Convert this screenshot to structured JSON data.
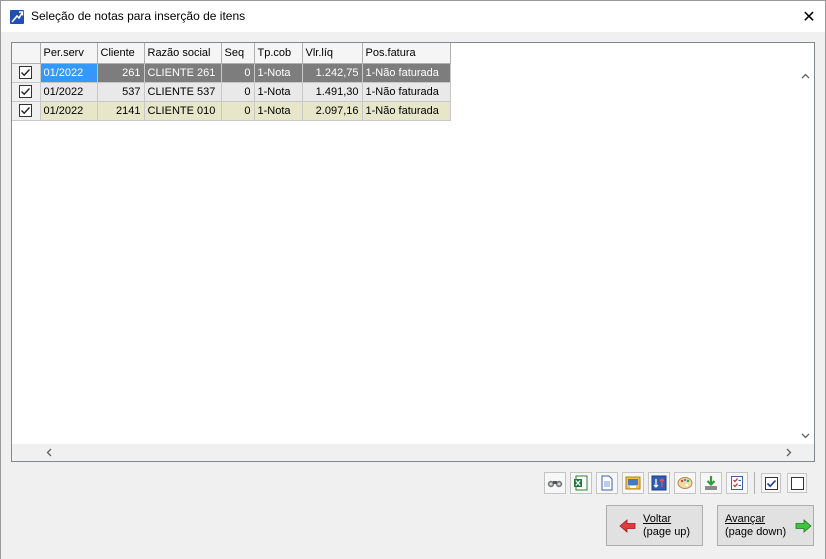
{
  "window": {
    "title": "Seleção de notas para inserção de itens",
    "close_glyph": "✕"
  },
  "grid": {
    "columns": [
      "Per.serv",
      "Cliente",
      "Razão social",
      "Seq",
      "Tp.cob",
      "Vlr.líq",
      "Pos.fatura"
    ],
    "rows": [
      {
        "checked": true,
        "per_serv": "01/2022",
        "cliente": "261",
        "razao": "CLIENTE 261",
        "seq": "0",
        "tp_cob": "1-Nota",
        "vlr_liq": "1.242,75",
        "pos_fatura": "1-Não faturada"
      },
      {
        "checked": true,
        "per_serv": "01/2022",
        "cliente": "537",
        "razao": "CLIENTE 537",
        "seq": "0",
        "tp_cob": "1-Nota",
        "vlr_liq": "1.491,30",
        "pos_fatura": "1-Não faturada"
      },
      {
        "checked": true,
        "per_serv": "01/2022",
        "cliente": "2141",
        "razao": "CLIENTE 010",
        "seq": "0",
        "tp_cob": "1-Nota",
        "vlr_liq": "2.097,16",
        "pos_fatura": "1-Não faturada"
      }
    ]
  },
  "toolbar": {
    "icons": [
      "binoculars-icon",
      "excel-export-icon",
      "document-icon",
      "print-preview-icon",
      "sort-icon",
      "palette-icon",
      "download-icon",
      "checklist-icon"
    ],
    "check_all": true,
    "uncheck_all": false
  },
  "buttons": {
    "back": {
      "line1": "Voltar",
      "line2": "(page up)"
    },
    "forward": {
      "line1": "Avançar",
      "line2": "(page down)"
    }
  },
  "colors": {
    "selected_cell": "#3399ff",
    "row1": "#7d7d7d",
    "row2": "#e9e9e9",
    "row3": "#e7e6c8",
    "back_arrow": "#e23b3b",
    "forward_arrow": "#3ec43e"
  }
}
